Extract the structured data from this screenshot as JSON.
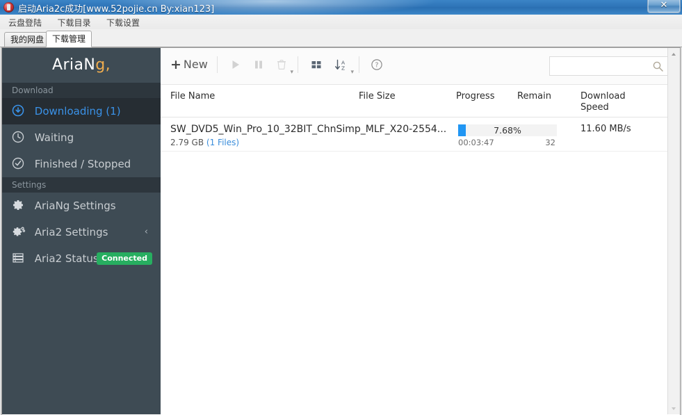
{
  "window": {
    "title": "启动Aria2c成功[www.52pojie.cn By:xian123]",
    "close_label": "✕",
    "app_icon": "app-icon"
  },
  "menubar": {
    "items": [
      {
        "label": "云盘登陆"
      },
      {
        "label": "下载目录"
      },
      {
        "label": "下载设置"
      }
    ]
  },
  "tabs": [
    {
      "label": "我的网盘",
      "active": false
    },
    {
      "label": "下载管理",
      "active": true
    }
  ],
  "sidebar": {
    "brand": {
      "text_main": "AriaN",
      "text_accent": "g",
      "dot": ","
    },
    "sections": [
      {
        "header": "Download"
      },
      {
        "header": "Settings"
      }
    ],
    "download_items": [
      {
        "label": "Downloading (1)",
        "icon": "download-circle-icon",
        "active": true
      },
      {
        "label": "Waiting",
        "icon": "clock-icon",
        "active": false
      },
      {
        "label": "Finished / Stopped",
        "icon": "check-circle-icon",
        "active": false
      }
    ],
    "settings_items": [
      {
        "label": "AriaNg Settings",
        "icon": "gear-icon",
        "chevron": ""
      },
      {
        "label": "Aria2 Settings",
        "icon": "gears-icon",
        "chevron": "‹"
      },
      {
        "label": "Aria2 Status",
        "icon": "server-icon",
        "badge": "Connected"
      }
    ]
  },
  "toolbar": {
    "new_label": "New",
    "new_plus": "+",
    "buttons": [
      {
        "name": "start-button",
        "icon": "play-icon"
      },
      {
        "name": "pause-button",
        "icon": "pause-icon"
      },
      {
        "name": "delete-button",
        "icon": "trash-icon",
        "caret": "▾"
      },
      {
        "name": "view-toggle-button",
        "icon": "grid-icon"
      },
      {
        "name": "sort-button",
        "icon": "sort-az-icon",
        "caret": "▾"
      },
      {
        "name": "help-button",
        "icon": "question-circle-icon"
      }
    ],
    "search": {
      "value": "",
      "placeholder": "",
      "icon": "search-icon"
    }
  },
  "table": {
    "columns": [
      {
        "key": "file_name",
        "label": "File Name"
      },
      {
        "key": "file_size",
        "label": "File Size"
      },
      {
        "key": "progress",
        "label": "Progress"
      },
      {
        "key": "remain",
        "label": "Remain"
      },
      {
        "key": "download_speed",
        "label": "Download\nSpeed"
      },
      {
        "key": "download_speed_l1",
        "label": "Download"
      },
      {
        "key": "download_speed_l2",
        "label": "Speed"
      }
    ],
    "rows": [
      {
        "file_name": "SW_DVD5_Win_Pro_10_32BIT_ChnSimp_MLF_X20-2554...",
        "file_size": "2.79 GB",
        "files_count": "(1 Files)",
        "progress_percent": "7.68%",
        "progress_value": 7.68,
        "remain_time": "00:03:47",
        "connections": "32",
        "download_speed": "11.60 MB/s"
      }
    ]
  },
  "colors": {
    "sidebar_bg": "#3e4b54",
    "sidebar_section_bg": "#2d363d",
    "sidebar_active_bg": "#262d33",
    "accent_blue": "#2196f3",
    "link_blue": "#3a8ddb",
    "badge_green": "#27ae60",
    "brand_accent": "#f0ad4e",
    "titlebar_blue": "#2e74b8"
  }
}
